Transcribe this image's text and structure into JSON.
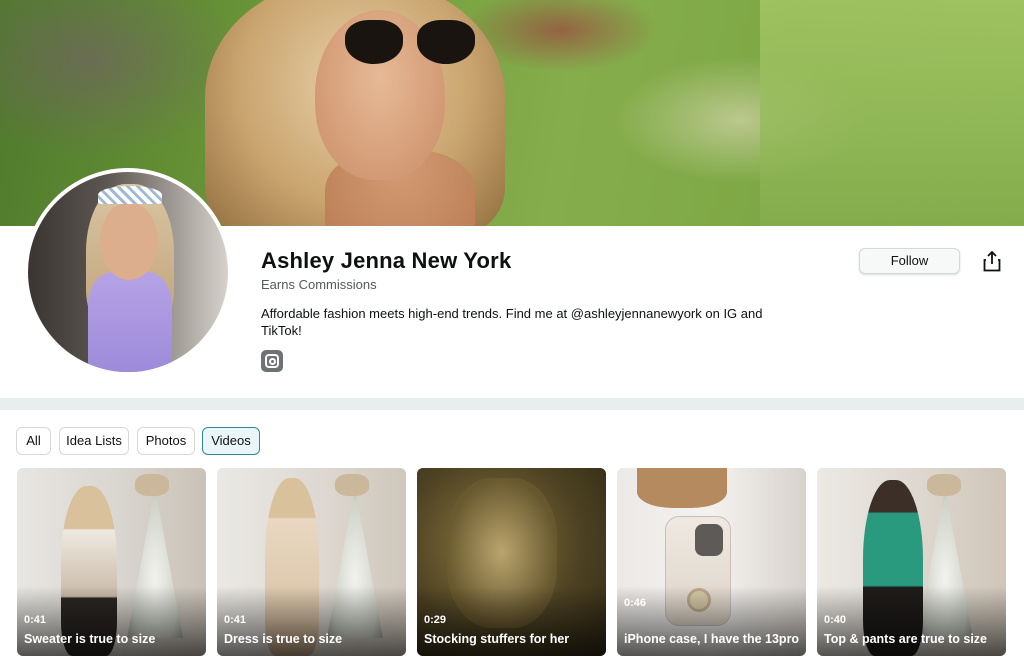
{
  "profile": {
    "name": "Ashley Jenna New York",
    "subtitle": "Earns Commissions",
    "bio": "Affordable fashion meets high-end trends. Find me at @ashleyjennanewyork on IG and TikTok!",
    "social_icon": "instagram-icon",
    "follow_label": "Follow",
    "share_icon": "share-icon"
  },
  "tabs": [
    {
      "label": "All",
      "active": false
    },
    {
      "label": "Idea Lists",
      "active": false
    },
    {
      "label": "Photos",
      "active": false
    },
    {
      "label": "Videos",
      "active": true
    }
  ],
  "videos": [
    {
      "duration": "0:41",
      "title": "Sweater is true to size"
    },
    {
      "duration": "0:41",
      "title": "Dress is true to size"
    },
    {
      "duration": "0:29",
      "title": "Stocking stuffers for her"
    },
    {
      "duration": "0:46",
      "title": "iPhone case, I have the 13pro"
    },
    {
      "duration": "0:40",
      "title": "Top & pants are true to size"
    }
  ],
  "colors": {
    "active_tab_border": "#2c8a96",
    "active_tab_bg": "#eaf7f8",
    "text_primary": "#0f1111",
    "text_secondary": "#565959"
  }
}
